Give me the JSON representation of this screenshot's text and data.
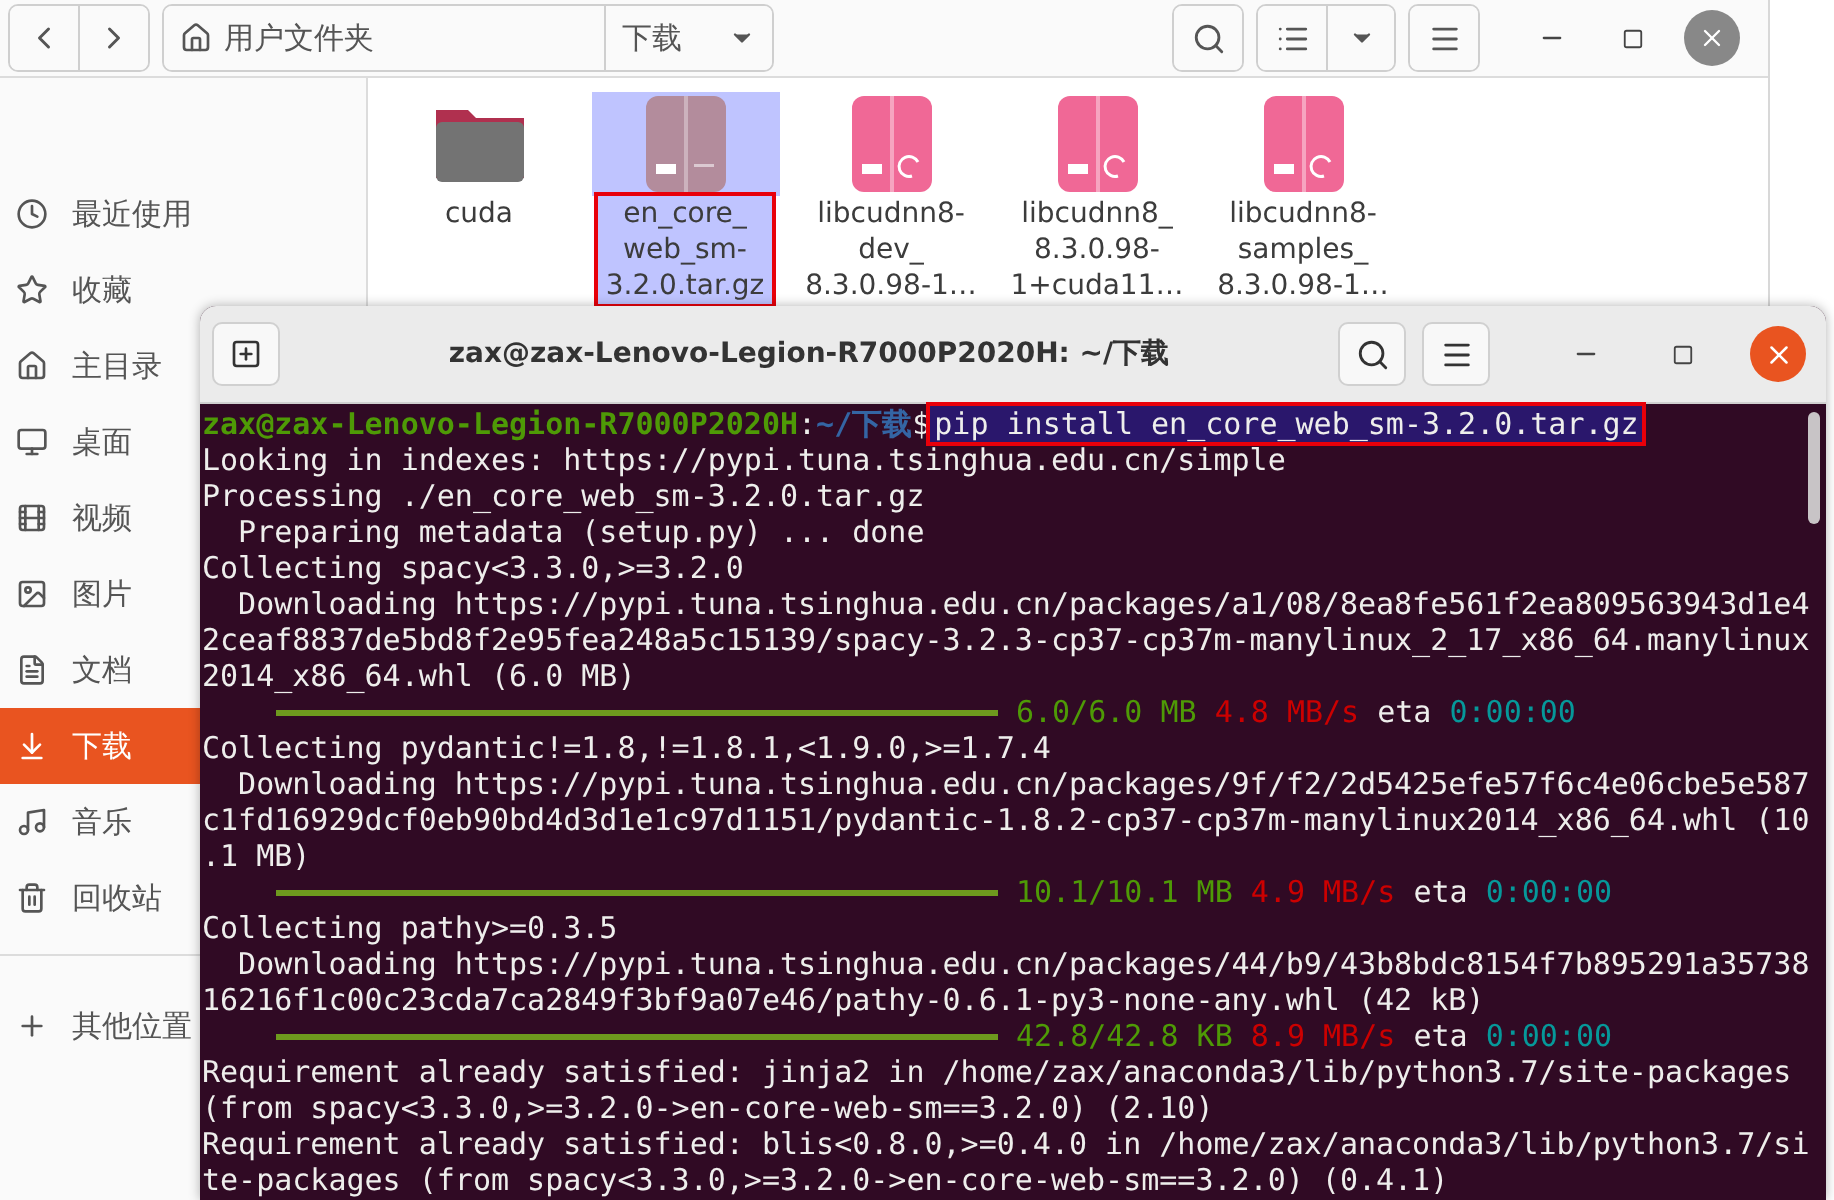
{
  "file_manager": {
    "path": [
      {
        "label": "用户文件夹",
        "kind": "home"
      },
      {
        "label": "下载",
        "kind": "current"
      }
    ],
    "sidebar": {
      "items": [
        {
          "label": "最近使用",
          "selected": false
        },
        {
          "label": "收藏",
          "selected": false
        },
        {
          "label": "主目录",
          "selected": false
        },
        {
          "label": "桌面",
          "selected": false
        },
        {
          "label": "视频",
          "selected": false
        },
        {
          "label": "图片",
          "selected": false
        },
        {
          "label": "文档",
          "selected": false
        },
        {
          "label": "下载",
          "selected": true
        },
        {
          "label": "音乐",
          "selected": false
        },
        {
          "label": "回收站",
          "selected": false
        }
      ],
      "other": {
        "label": "其他位置"
      }
    },
    "files": [
      {
        "kind": "folder",
        "label_lines": [
          "cuda"
        ],
        "selected": false
      },
      {
        "kind": "archive",
        "label_lines": [
          "en_core_",
          "web_sm-",
          "3.2.0.tar.gz"
        ],
        "selected": true
      },
      {
        "kind": "deb",
        "label_lines": [
          "libcudnn8-",
          "dev_",
          "8.3.0.98-1…"
        ],
        "selected": false
      },
      {
        "kind": "deb",
        "label_lines": [
          "libcudnn8_",
          "8.3.0.98-",
          "1+cuda11…"
        ],
        "selected": false
      },
      {
        "kind": "deb",
        "label_lines": [
          "libcudnn8-",
          "samples_",
          "8.3.0.98-1…"
        ],
        "selected": false
      }
    ]
  },
  "terminal": {
    "title": "zax@zax-Lenovo-Legion-R7000P2020H: ~/下载",
    "lines": [
      {
        "kind": "prompt",
        "user": "zax@zax-Lenovo-Legion-R7000P2020H",
        "sep": ":",
        "path": "~/下载",
        "symbol": "$",
        "command": "pip install en_core_web_sm-3.2.0.tar.gz",
        "selected": true
      },
      {
        "kind": "text",
        "text": "Looking in indexes: https://pypi.tuna.tsinghua.edu.cn/simple"
      },
      {
        "kind": "text",
        "text": "Processing ./en_core_web_sm-3.2.0.tar.gz"
      },
      {
        "kind": "text",
        "text": "  Preparing metadata (setup.py) ... done"
      },
      {
        "kind": "text",
        "text": "Collecting spacy<3.3.0,>=3.2.0"
      },
      {
        "kind": "text",
        "text": "  Downloading https://pypi.tuna.tsinghua.edu.cn/packages/a1/08/8ea8fe561f2ea809563943d1e4"
      },
      {
        "kind": "text",
        "text": "2ceaf8837de5bd8f2e95fea248a5c15139/spacy-3.2.3-cp37-cp37m-manylinux_2_17_x86_64.manylinux"
      },
      {
        "kind": "text",
        "text": "2014_x86_64.whl (6.0 MB)"
      },
      {
        "kind": "progress",
        "level": 1,
        "done": "6.0/6.0 MB",
        "speed": "4.8 MB/s",
        "eta_label": "eta",
        "eta": "0:00:00"
      },
      {
        "kind": "text",
        "text": "Collecting pydantic!=1.8,!=1.8.1,<1.9.0,>=1.7.4"
      },
      {
        "kind": "text",
        "text": "  Downloading https://pypi.tuna.tsinghua.edu.cn/packages/9f/f2/2d5425efe57f6c4e06cbe5e587"
      },
      {
        "kind": "text",
        "text": "c1fd16929dcf0eb90bd4d3d1e1c97d1151/pydantic-1.8.2-cp37-cp37m-manylinux2014_x86_64.whl (10"
      },
      {
        "kind": "text",
        "text": ".1 MB)"
      },
      {
        "kind": "progress",
        "level": 1,
        "done": "10.1/10.1 MB",
        "speed": "4.9 MB/s",
        "eta_label": "eta",
        "eta": "0:00:00"
      },
      {
        "kind": "text",
        "text": "Collecting pathy>=0.3.5"
      },
      {
        "kind": "text",
        "text": "  Downloading https://pypi.tuna.tsinghua.edu.cn/packages/44/b9/43b8bdc8154f7b895291a35738"
      },
      {
        "kind": "text",
        "text": "16216f1c00c23cda7ca2849f3bf9a07e46/pathy-0.6.1-py3-none-any.whl (42 kB)"
      },
      {
        "kind": "progress",
        "level": 1,
        "done": "42.8/42.8 KB",
        "speed": "8.9 MB/s",
        "eta_label": "eta",
        "eta": "0:00:00"
      },
      {
        "kind": "text",
        "text": "Requirement already satisfied: jinja2 in /home/zax/anaconda3/lib/python3.7/site-packages"
      },
      {
        "kind": "text",
        "text": "(from spacy<3.3.0,>=3.2.0->en-core-web-sm==3.2.0) (2.10)"
      },
      {
        "kind": "text",
        "text": "Requirement already satisfied: blis<0.8.0,>=0.4.0 in /home/zax/anaconda3/lib/python3.7/si"
      },
      {
        "kind": "text",
        "text": "te-packages (from spacy<3.3.0,>=3.2.0->en-core-web-sm==3.2.0) (0.4.1)"
      }
    ]
  }
}
